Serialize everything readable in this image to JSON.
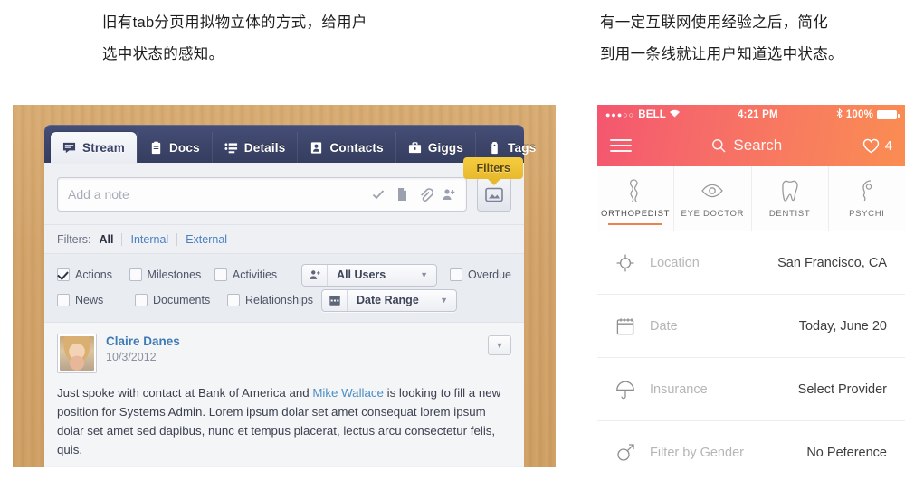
{
  "captions": {
    "left": [
      "旧有tab分页用拟物立体的方式，给用户",
      "选中状态的感知。"
    ],
    "right": [
      "有一定互联网使用经验之后，简化",
      "到用一条线就让用户知道选中状态。"
    ]
  },
  "left_app": {
    "tabs": [
      {
        "label": "Stream",
        "icon": "stream-icon",
        "active": true
      },
      {
        "label": "Docs",
        "icon": "clipboard-icon",
        "active": false
      },
      {
        "label": "Details",
        "icon": "list-icon",
        "active": false
      },
      {
        "label": "Contacts",
        "icon": "contact-icon",
        "active": false
      },
      {
        "label": "Giggs",
        "icon": "briefcase-icon",
        "active": false
      },
      {
        "label": "Tags",
        "icon": "tag-icon",
        "active": false
      }
    ],
    "tooltip": "Filters",
    "composer": {
      "placeholder": "Add a note",
      "icons": [
        "check-icon",
        "document-icon",
        "paperclip-icon",
        "add-person-icon"
      ],
      "image_button": "image-icon"
    },
    "filters": {
      "label": "Filters:",
      "all": "All",
      "links": [
        "Internal",
        "External"
      ]
    },
    "checkboxes_row1": [
      {
        "label": "Actions",
        "checked": true
      },
      {
        "label": "Milestones",
        "checked": false
      },
      {
        "label": "Activities",
        "checked": false
      }
    ],
    "checkboxes_row2": [
      {
        "label": "News",
        "checked": false
      },
      {
        "label": "Documents",
        "checked": false
      },
      {
        "label": "Relationships",
        "checked": false
      }
    ],
    "overdue": {
      "label": "Overdue",
      "checked": false
    },
    "selects": [
      {
        "label": "All Users",
        "icon": "users-icon"
      },
      {
        "label": "Date Range",
        "icon": "calendar-icon"
      }
    ],
    "post": {
      "author": "Claire Danes",
      "date": "10/3/2012",
      "body_before": "Just spoke with contact at Bank of America and ",
      "body_link": "Mike Wallace",
      "body_after": " is looking to fill a new position for Systems Admin. Lorem ipsum dolar set amet consequat lorem ipsum dolar set amet sed dapibus, nunc et tempus placerat, lectus arcu consectetur felis, quis."
    }
  },
  "right_app": {
    "status": {
      "carrier": "BELL",
      "dots": "●●●○○",
      "wifi": "wifi-icon",
      "time": "4:21 PM",
      "bluetooth": "bluetooth-icon",
      "battery": "100%"
    },
    "nav": {
      "menu": "hamburger-icon",
      "search": "Search",
      "search_icon": "search-icon",
      "favorites_icon": "heart-icon",
      "favorites_count": "4"
    },
    "specialties": [
      {
        "label": "ORTHOPEDIST",
        "icon": "bone-icon",
        "active": true
      },
      {
        "label": "EYE DOCTOR",
        "icon": "eye-icon",
        "active": false
      },
      {
        "label": "DENTIST",
        "icon": "tooth-icon",
        "active": false
      },
      {
        "label": "PSYCHI",
        "icon": "head-icon",
        "active": false
      }
    ],
    "rows": [
      {
        "label": "Location",
        "value": "San Francisco, CA",
        "icon": "target-icon"
      },
      {
        "label": "Date",
        "value": "Today, June 20",
        "icon": "calendar-icon"
      },
      {
        "label": "Insurance",
        "value": "Select Provider",
        "icon": "umbrella-icon"
      },
      {
        "label": "Filter by Gender",
        "value": "No Peference",
        "icon": "gender-icon"
      }
    ]
  },
  "colors": {
    "tabbar_navy": "#3c4469",
    "tooltip_yellow": "#e9b92c",
    "ios_pink": "#f4566f",
    "ios_orange": "#fa8d52",
    "accent_underline": "#e8834f",
    "link_blue": "#4a8ec4",
    "wood": "#d2a369"
  }
}
